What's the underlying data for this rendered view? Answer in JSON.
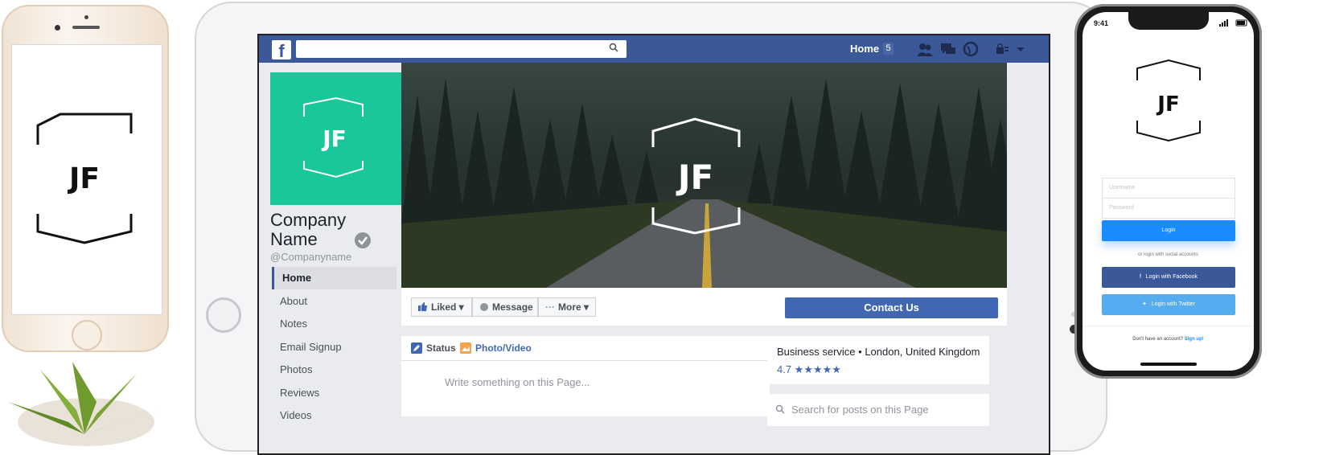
{
  "logo_text": "JF",
  "tablet": {
    "header": {
      "fb_logo": "f",
      "home_label": "Home",
      "home_badge": "5"
    },
    "profile": {
      "company_name": "Company Name",
      "handle": "@Companyname"
    },
    "nav": [
      "Home",
      "About",
      "Notes",
      "Email Signup",
      "Photos",
      "Reviews",
      "Videos"
    ],
    "actions": {
      "liked": "Liked",
      "message": "Message",
      "more": "More",
      "contact": "Contact Us"
    },
    "post": {
      "status_tab": "Status",
      "photo_tab": "Photo/Video",
      "placeholder": "Write something on this Page..."
    },
    "info": {
      "business": "Business service • London, United Kingdom",
      "rating": "4.7 ★★★★★"
    },
    "search_posts_placeholder": "Search for posts on this Page"
  },
  "phone_right": {
    "time": "9:41",
    "username_placeholder": "Username",
    "password_placeholder": "Password",
    "login_label": "Login",
    "or_text": "or login with social accounts",
    "facebook_label": "Login with Facebook",
    "twitter_label": "Login with Twitter",
    "signup_text": "Don't have an account?",
    "signup_link": "Sign up!"
  },
  "colors": {
    "facebook_blue": "#3b5998",
    "profile_green": "#19c79a",
    "contact_blue": "#4267b2",
    "twitter_blue": "#55acee",
    "login_blue": "#1a8cff"
  }
}
